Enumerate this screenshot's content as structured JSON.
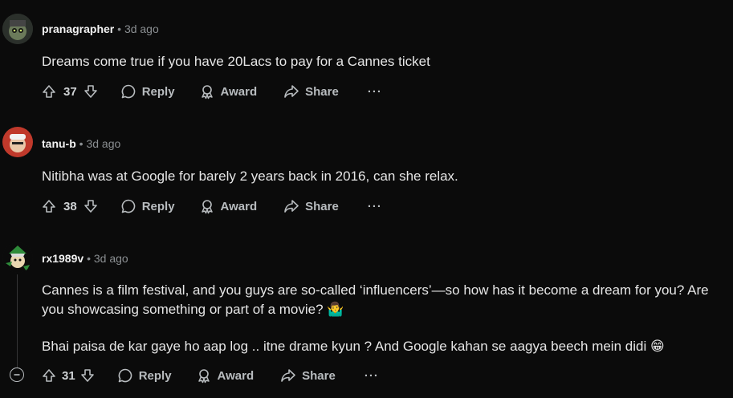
{
  "comments": [
    {
      "user": "pranagrapher",
      "time": "3d ago",
      "text": "Dreams come true if you have 20Lacs to pay for a Cannes ticket",
      "votes": "37",
      "reply": "Reply",
      "award": "Award",
      "share": "Share",
      "more": "···"
    },
    {
      "user": "tanu-b",
      "time": "3d ago",
      "text": "Nitibha was at Google for barely 2 years back in 2016, can she relax.",
      "votes": "38",
      "reply": "Reply",
      "award": "Award",
      "share": "Share",
      "more": "···"
    },
    {
      "user": "rx1989v",
      "time": "3d ago",
      "text_p1": "Cannes is a film festival, and you guys are so-called ‘influencers’—so how has it become a dream for you? Are you showcasing something or part of a movie? 🤷‍♂️",
      "text_p2": "Bhai paisa de kar gaye ho aap log .. itne drame kyun ? And Google kahan se aagya beech mein didi 😁",
      "votes": "31",
      "reply": "Reply",
      "award": "Award",
      "share": "Share",
      "more": "···"
    }
  ],
  "separator": "•",
  "colors": {
    "background": "#0b0b0b",
    "text": "#d7dadc",
    "muted": "#8b8f92"
  }
}
